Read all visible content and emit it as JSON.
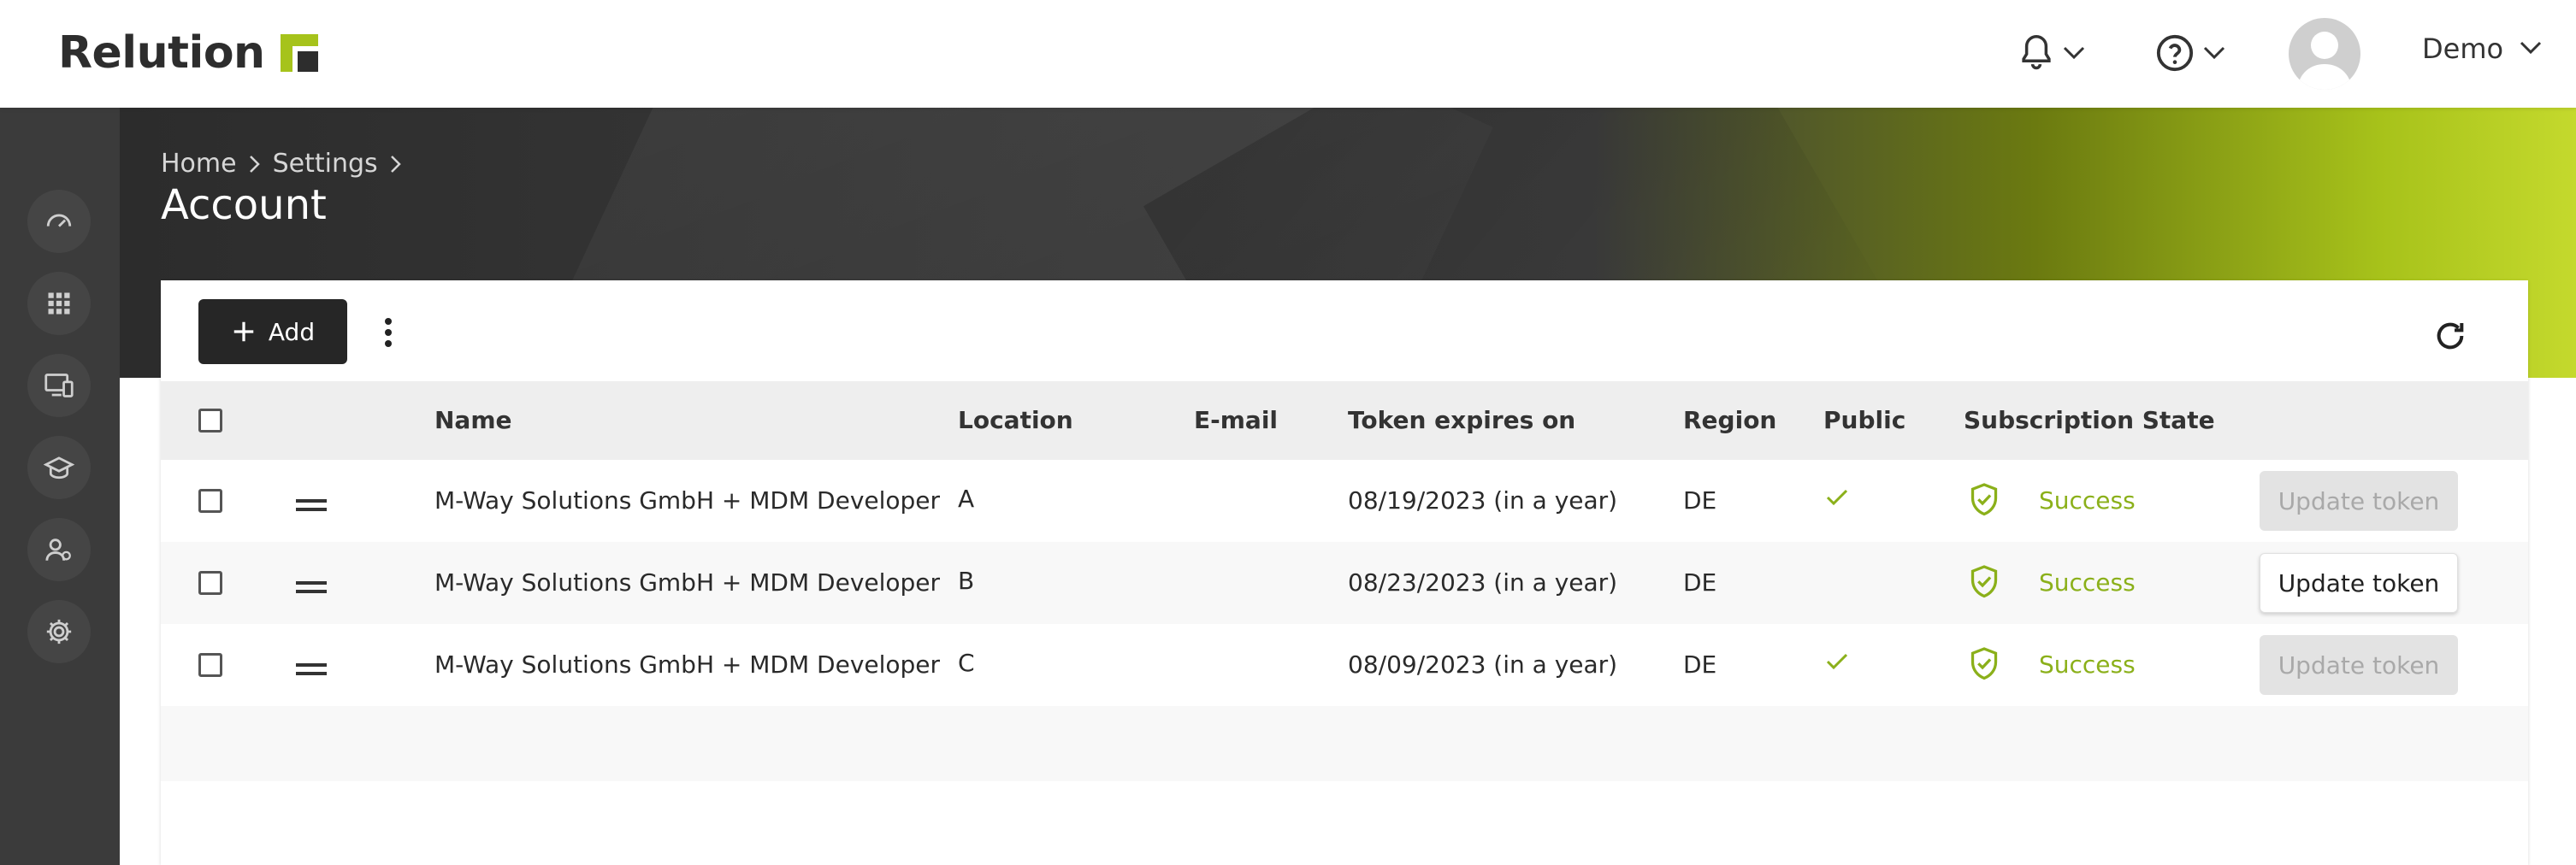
{
  "app": {
    "brand": "Relution",
    "brand_color": "#a6c31b",
    "icons": {
      "notifications": "bell-icon",
      "help": "help-circle-icon"
    },
    "user": {
      "name": "Demo"
    }
  },
  "sidebar": {
    "items": [
      {
        "icon": "dashboard-gauge-icon"
      },
      {
        "icon": "apps-grid-icon"
      },
      {
        "icon": "devices-icon"
      },
      {
        "icon": "education-cap-icon"
      },
      {
        "icon": "users-icon"
      },
      {
        "icon": "settings-gear-icon"
      }
    ]
  },
  "header": {
    "breadcrumb": [
      "Home",
      "Settings"
    ],
    "title": "Account"
  },
  "toolbar": {
    "add_label": "Add",
    "more_icon": "more-vertical-icon",
    "refresh_icon": "refresh-icon"
  },
  "table": {
    "columns": [
      "Name",
      "Location",
      "E-mail",
      "Token expires on",
      "Region",
      "Public",
      "Subscription State"
    ],
    "rows": [
      {
        "name": "M-Way Solutions GmbH + MDM Developer",
        "location": "A",
        "email": "",
        "expires": "08/19/2023 (in a year)",
        "region": "DE",
        "public": true,
        "state": "Success",
        "action": "Update token",
        "action_enabled": false
      },
      {
        "name": "M-Way Solutions GmbH + MDM Developer",
        "location": "B",
        "email": "",
        "expires": "08/23/2023 (in a year)",
        "region": "DE",
        "public": false,
        "state": "Success",
        "action": "Update token",
        "action_enabled": true
      },
      {
        "name": "M-Way Solutions GmbH + MDM Developer",
        "location": "C",
        "email": "",
        "expires": "08/09/2023 (in a year)",
        "region": "DE",
        "public": true,
        "state": "Success",
        "action": "Update token",
        "action_enabled": false
      }
    ]
  },
  "colors": {
    "success": "#8bb01a",
    "dark": "#262626"
  }
}
